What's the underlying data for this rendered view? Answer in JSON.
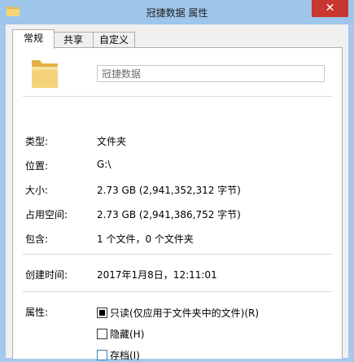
{
  "window": {
    "title": "冠捷数据 属性",
    "close_glyph": "✕"
  },
  "tabs": [
    {
      "label": "常规",
      "active": true
    },
    {
      "label": "共享",
      "active": false
    },
    {
      "label": "自定义",
      "active": false
    }
  ],
  "general": {
    "name_value": "冠捷数据",
    "rows": {
      "type": {
        "label": "类型:",
        "value": "文件夹"
      },
      "location": {
        "label": "位置:",
        "value": "G:\\"
      },
      "size": {
        "label": "大小:",
        "value": "2.73 GB (2,941,352,312 字节)"
      },
      "size_on_disk": {
        "label": "占用空间:",
        "value": "2.73 GB (2,941,386,752 字节)"
      },
      "contains": {
        "label": "包含:",
        "value": "1 个文件，0 个文件夹"
      },
      "created": {
        "label": "创建时间:",
        "value": "2017年1月8日，12:11:01"
      }
    },
    "attributes": {
      "label": "属性:",
      "readonly": {
        "label": "只读(仅应用于文件夹中的文件)(R)",
        "state": "indeterminate"
      },
      "hidden": {
        "label": "隐藏(H)",
        "state": "unchecked"
      },
      "archive": {
        "label": "存档(I)",
        "state": "unchecked"
      }
    }
  },
  "colors": {
    "titlebar": "#9ec5ea",
    "close": "#c7372f",
    "folder": "#f3d27a"
  }
}
